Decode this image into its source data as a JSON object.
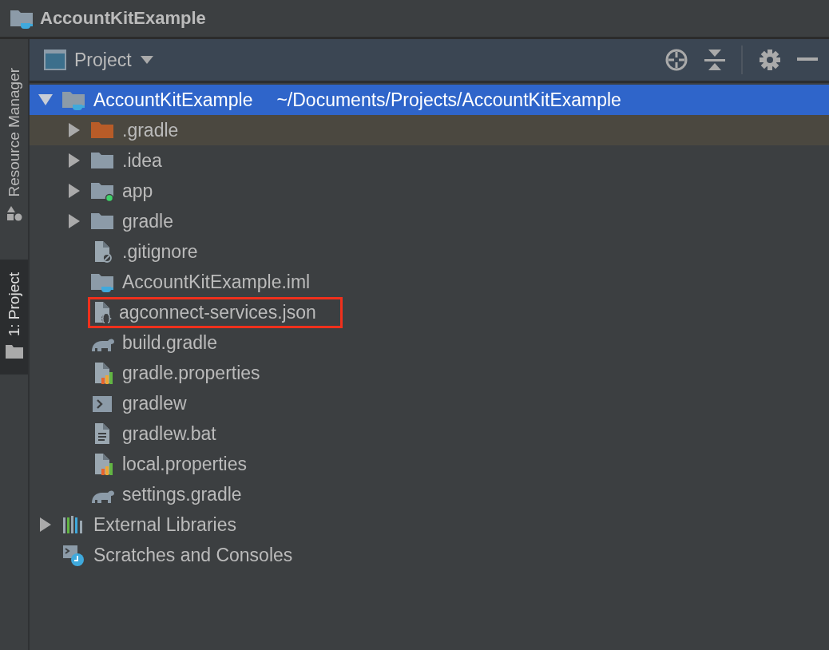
{
  "window": {
    "title": "AccountKitExample"
  },
  "side_tabs": [
    {
      "label": "Resource Manager",
      "kind": "resources",
      "selected": false
    },
    {
      "label": "1: Project",
      "kind": "project",
      "selected": true
    }
  ],
  "panel": {
    "title": "Project"
  },
  "tree": [
    {
      "label": "AccountKitExample",
      "path": "~/Documents/Projects/AccountKitExample",
      "kind": "project-folder",
      "expanded": true,
      "selected": true,
      "highlighted": false,
      "annotated": false,
      "children": [
        {
          "label": ".gradle",
          "kind": "excluded-folder",
          "expanded": false,
          "selected": false,
          "highlighted": true,
          "annotated": false
        },
        {
          "label": ".idea",
          "kind": "folder",
          "expanded": false,
          "selected": false,
          "highlighted": false,
          "annotated": false
        },
        {
          "label": "app",
          "kind": "module-folder",
          "expanded": false,
          "selected": false,
          "highlighted": false,
          "annotated": false
        },
        {
          "label": "gradle",
          "kind": "folder",
          "expanded": false,
          "selected": false,
          "highlighted": false,
          "annotated": false
        },
        {
          "label": ".gitignore",
          "kind": "ignore-file",
          "selected": false,
          "highlighted": false,
          "annotated": false
        },
        {
          "label": "AccountKitExample.iml",
          "kind": "module-file",
          "selected": false,
          "highlighted": false,
          "annotated": false
        },
        {
          "label": "agconnect-services.json",
          "kind": "json-file",
          "selected": false,
          "highlighted": false,
          "annotated": true
        },
        {
          "label": "build.gradle",
          "kind": "gradle-file",
          "selected": false,
          "highlighted": false,
          "annotated": false
        },
        {
          "label": "gradle.properties",
          "kind": "properties-file",
          "selected": false,
          "highlighted": false,
          "annotated": false
        },
        {
          "label": "gradlew",
          "kind": "script-file",
          "selected": false,
          "highlighted": false,
          "annotated": false
        },
        {
          "label": "gradlew.bat",
          "kind": "text-file",
          "selected": false,
          "highlighted": false,
          "annotated": false
        },
        {
          "label": "local.properties",
          "kind": "properties-file",
          "selected": false,
          "highlighted": false,
          "annotated": false
        },
        {
          "label": "settings.gradle",
          "kind": "gradle-file",
          "selected": false,
          "highlighted": false,
          "annotated": false
        }
      ]
    },
    {
      "label": "External Libraries",
      "kind": "libraries",
      "expanded": false,
      "selected": false,
      "highlighted": false,
      "annotated": false
    },
    {
      "label": "Scratches and Consoles",
      "kind": "scratches",
      "selected": false,
      "highlighted": false,
      "annotated": false
    }
  ]
}
